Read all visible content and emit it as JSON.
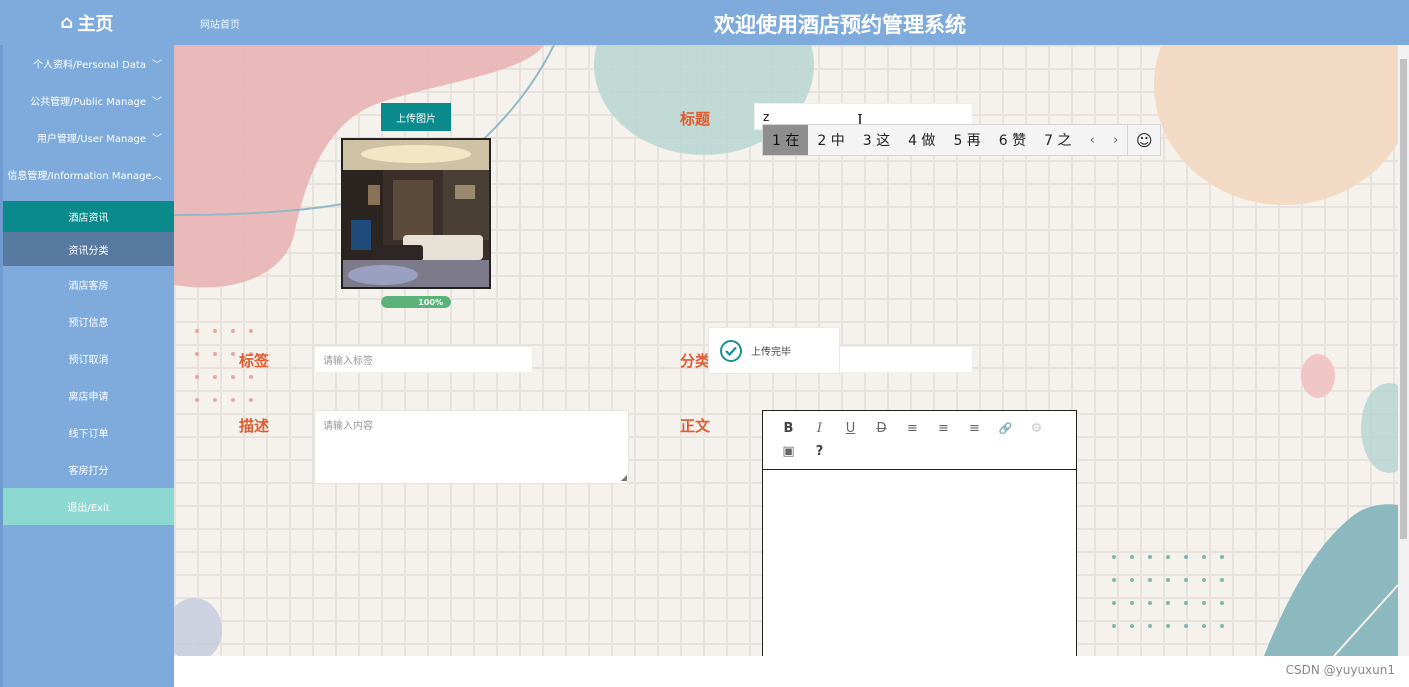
{
  "header": {
    "home_label": "主页",
    "home_icon": "home-icon",
    "site_home_link": "网站首页",
    "system_title": "欢迎使用酒店预约管理系统"
  },
  "sidebar": {
    "menus": [
      {
        "label": "个人资料/Personal Data",
        "expanded": false
      },
      {
        "label": "公共管理/Public Manage",
        "expanded": false
      },
      {
        "label": "用户管理/User Manage",
        "expanded": false
      },
      {
        "label": "信息管理/Information Manage",
        "expanded": true
      }
    ],
    "sub_items": [
      {
        "label": "酒店资讯",
        "state": "active"
      },
      {
        "label": "资讯分类",
        "state": "hover"
      },
      {
        "label": "酒店客房",
        "state": "normal"
      },
      {
        "label": "预订信息",
        "state": "normal"
      },
      {
        "label": "预订取消",
        "state": "normal"
      },
      {
        "label": "离店申请",
        "state": "normal"
      },
      {
        "label": "线下订单",
        "state": "normal"
      },
      {
        "label": "客房打分",
        "state": "normal"
      }
    ],
    "exit_label": "退出/Exit"
  },
  "form": {
    "upload_button": "上传图片",
    "progress_percent": 100,
    "progress_text": "100%",
    "title_label": "标题",
    "title_value": "z",
    "tag_label": "标签",
    "tag_placeholder": "请输入标签",
    "category_label": "分类",
    "desc_label": "描述",
    "desc_placeholder": "请输入内容",
    "body_label": "正文"
  },
  "ime": {
    "candidates": [
      "1 在",
      "2 中",
      "3 这",
      "4 做",
      "5 再",
      "6 赞",
      "7 之"
    ],
    "selected_index": 0,
    "prev": "‹",
    "next": "›",
    "emoji": "☺"
  },
  "toast": {
    "text": "上传完毕",
    "icon": "check-circle-icon"
  },
  "editor": {
    "toolbar": [
      "B",
      "I",
      "U",
      "D",
      "≡",
      "≡",
      "≡",
      "🔗",
      "⚙",
      "▣",
      "?"
    ]
  },
  "footer": {
    "credit": "CSDN @yuyuxun1"
  },
  "colors": {
    "header_bg": "#7fabdc",
    "active_teal": "#0b8a8c",
    "label_orange": "#e25a2e",
    "exit_bg": "#8dd9d1"
  }
}
